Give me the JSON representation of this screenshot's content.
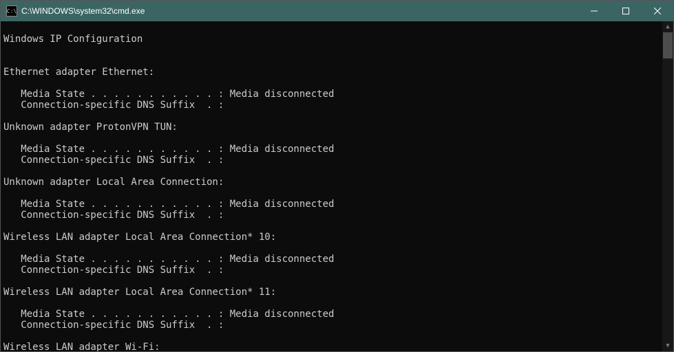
{
  "window": {
    "title": "C:\\WINDOWS\\system32\\cmd.exe",
    "icon_label": "cmd-icon"
  },
  "terminal": {
    "header": "Windows IP Configuration",
    "adapters": [
      {
        "name": "Ethernet adapter Ethernet:",
        "media_line": "   Media State . . . . . . . . . . . : Media disconnected",
        "dns_line": "   Connection-specific DNS Suffix  . :"
      },
      {
        "name": "Unknown adapter ProtonVPN TUN:",
        "media_line": "   Media State . . . . . . . . . . . : Media disconnected",
        "dns_line": "   Connection-specific DNS Suffix  . :"
      },
      {
        "name": "Unknown adapter Local Area Connection:",
        "media_line": "   Media State . . . . . . . . . . . : Media disconnected",
        "dns_line": "   Connection-specific DNS Suffix  . :"
      },
      {
        "name": "Wireless LAN adapter Local Area Connection* 10:",
        "media_line": "   Media State . . . . . . . . . . . : Media disconnected",
        "dns_line": "   Connection-specific DNS Suffix  . :"
      },
      {
        "name": "Wireless LAN adapter Local Area Connection* 11:",
        "media_line": "   Media State . . . . . . . . . . . : Media disconnected",
        "dns_line": "   Connection-specific DNS Suffix  . :"
      },
      {
        "name": "Wireless LAN adapter Wi-Fi:"
      }
    ]
  }
}
